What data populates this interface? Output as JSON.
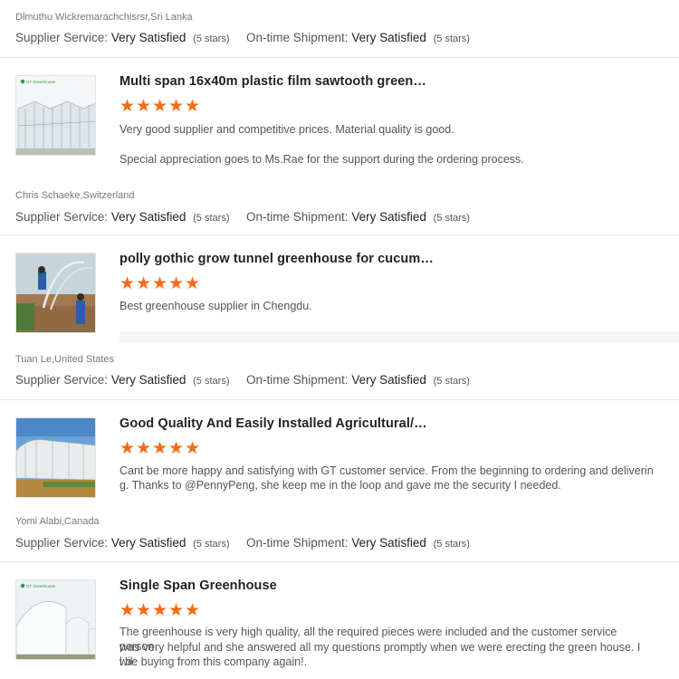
{
  "labels": {
    "supplier_service": "Supplier Service:",
    "ontime_shipment": "On-time Shipment:"
  },
  "top": {
    "buyer": "Dlmuthu Wickremarachchisrsr,Sri Lanka",
    "supplier_value": "Very Satisfied",
    "supplier_stars": "(5 stars)",
    "shipment_value": "Very Satisfied",
    "shipment_stars": "(5 stars)"
  },
  "reviews": [
    {
      "title": "Multi span 16x40m plastic film sawtooth green…",
      "rating": 5,
      "text1": "Very good supplier and competitive prices. Material quality is good.",
      "text2": "Special appreciation goes to Ms.Rae for the support during the ordering process.",
      "buyer": "Chris Schaeke,Switzerland",
      "supplier_value": "Very Satisfied",
      "supplier_stars": "(5 stars)",
      "shipment_value": "Very Satisfied",
      "shipment_stars": "(5 stars)",
      "thumb_brand": "GT Greenhouse"
    },
    {
      "title": "polly gothic grow tunnel greenhouse for cucum…",
      "rating": 5,
      "text1": "Best greenhouse supplier in Chengdu.",
      "buyer": "Tuan Le,United States",
      "supplier_value": "Very Satisfied",
      "supplier_stars": "(5 stars)",
      "shipment_value": "Very Satisfied",
      "shipment_stars": "(5 stars)"
    },
    {
      "title": "Good Quality And Easily Installed Agricultural/…",
      "rating": 5,
      "text1": "Cant be more happy and satisfying with GT customer service. From the beginning to ordering and deliverin",
      "text2": "g. Thanks to @PennyPeng, she keep me in the loop and gave me the security I needed.",
      "buyer": "Yomi Alabi,Canada",
      "supplier_value": "Very Satisfied",
      "supplier_stars": "(5 stars)",
      "shipment_value": "Very Satisfied",
      "shipment_stars": "(5 stars)"
    },
    {
      "title": "Single Span Greenhouse",
      "rating": 5,
      "text1": "The greenhouse is very high quality, all the required pieces were included and the customer service person",
      "text2": "was very helpful and she answered all my questions promptly when we were erecting the green house. I wil",
      "text3": "l be buying from this company again!.",
      "thumb_brand": "GT Greenhouse"
    }
  ],
  "colors": {
    "star": "#f26c16",
    "divider": "#e6e6e6",
    "brand_green": "#2a9d3a"
  },
  "icons": {
    "star": "star-icon"
  }
}
